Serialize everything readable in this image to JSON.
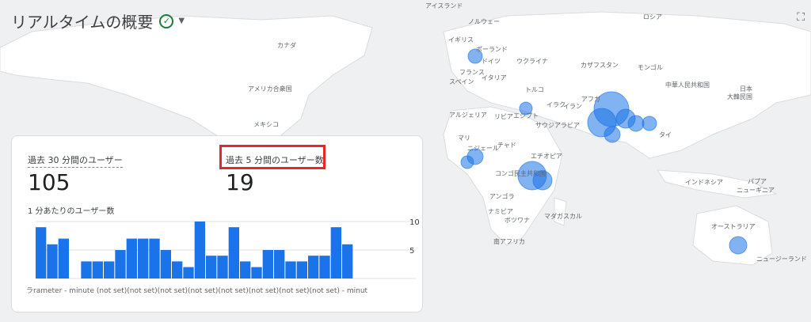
{
  "header": {
    "title": "リアルタイムの概要",
    "status_icon": "check-circle-icon",
    "dropdown_icon": "caret-down-icon",
    "fullscreen_icon": "fullscreen-icon"
  },
  "map": {
    "labels": [
      "アイスランド",
      "ノルウェー",
      "ロシア",
      "イギリス",
      "ポーランド",
      "ウクライナ",
      "カザフスタン",
      "モンゴル",
      "カナダ",
      "フランス",
      "ドイツ",
      "スペイン",
      "イタリア",
      "トルコ",
      "大韓民国",
      "日本",
      "アメリカ合衆国",
      "中華人民共和国",
      "アフガ",
      "イラク",
      "イラン",
      "リビア",
      "エジプト",
      "アルジェリア",
      "サウジアラビア",
      "タイ",
      "メキシコ",
      "マリ",
      "ニジェール",
      "チャド",
      "エチオピア",
      "コンゴ民主共和国",
      "アンゴラ",
      "ナミビア",
      "ボツワナ",
      "マダガスカル",
      "南アフリカ",
      "インドネシア",
      "パプア",
      "ニューギニア",
      "オーストラリア",
      "ニュージーランド"
    ],
    "accent_color": "#1a73e8"
  },
  "card": {
    "metric1": {
      "label": "過去 30 分間のユーザー",
      "value": "105"
    },
    "metric2": {
      "label": "過去 5 分間のユーザー数",
      "value": "19"
    },
    "chart_title": "1 分あたりのユーザー数",
    "x_ticks_text": "ラrameter - minute (not set)(not set)(not set)(not set)(not set)(not set)(not set)(not set) - minut"
  },
  "chart_data": {
    "type": "bar",
    "title": "1 分あたりのユーザー数",
    "yticks": [
      5,
      10
    ],
    "ylim": [
      0,
      10
    ],
    "values": [
      9,
      6,
      7,
      0,
      3,
      3,
      3,
      5,
      7,
      7,
      7,
      5,
      3,
      2,
      10,
      4,
      4,
      9,
      3,
      2,
      5,
      5,
      3,
      3,
      4,
      4,
      9,
      6,
      0,
      0
    ]
  }
}
